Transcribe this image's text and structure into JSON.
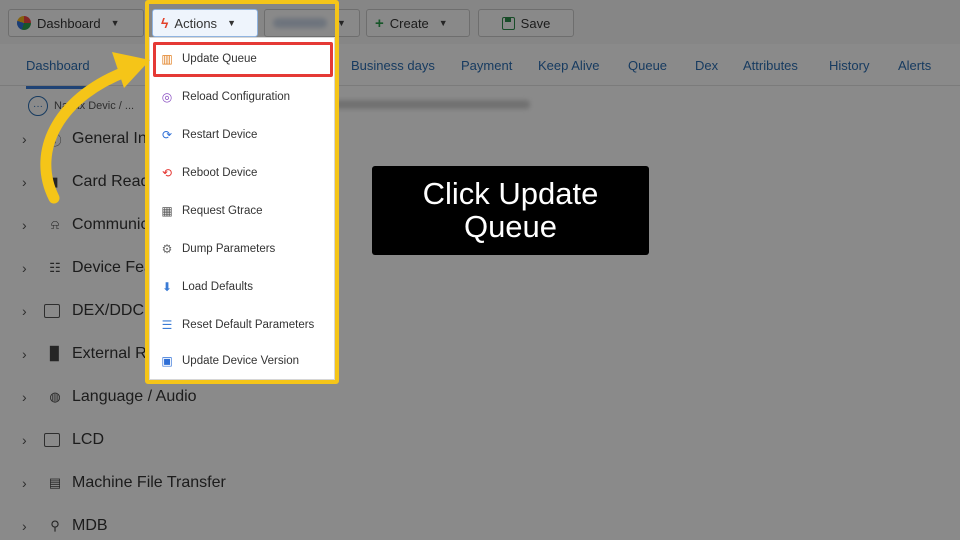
{
  "toolbar": {
    "dashboard_label": "Dashboard",
    "actions_label": "Actions",
    "create_label": "Create",
    "save_label": "Save"
  },
  "tabs": [
    {
      "label": "Dashboard"
    },
    {
      "label": "Business days"
    },
    {
      "label": "Payment"
    },
    {
      "label": "Keep Alive"
    },
    {
      "label": "Queue"
    },
    {
      "label": "Dex"
    },
    {
      "label": "Attributes"
    },
    {
      "label": "History"
    },
    {
      "label": "Alerts"
    }
  ],
  "breadcrumb": {
    "text": "Nayax Devic / ..."
  },
  "tree": [
    {
      "label": "General In",
      "icon": "info-icon"
    },
    {
      "label": "Card Read",
      "icon": "card-reader-icon"
    },
    {
      "label": "Communic",
      "icon": "antenna-icon"
    },
    {
      "label": "Device Fea",
      "icon": "features-icon"
    },
    {
      "label": "DEX/DDCI",
      "icon": "dex-icon"
    },
    {
      "label": "External R",
      "icon": "external-reader-icon"
    },
    {
      "label": "Language / Audio",
      "icon": "globe-icon"
    },
    {
      "label": "LCD",
      "icon": "lcd-icon"
    },
    {
      "label": "Machine File Transfer",
      "icon": "ftp-icon"
    },
    {
      "label": "MDB",
      "icon": "mdb-icon"
    }
  ],
  "menu": {
    "items": [
      {
        "label": "Update Queue",
        "icon": "queue-icon"
      },
      {
        "label": "Reload Configuration",
        "icon": "reload-config-icon"
      },
      {
        "label": "Restart Device",
        "icon": "restart-icon"
      },
      {
        "label": "Reboot Device",
        "icon": "reboot-icon"
      },
      {
        "label": "Request Gtrace",
        "icon": "gtrace-icon"
      },
      {
        "label": "Dump Parameters",
        "icon": "dump-icon"
      },
      {
        "label": "Load Defaults",
        "icon": "load-defaults-icon"
      },
      {
        "label": "Reset Default Parameters",
        "icon": "reset-params-icon"
      },
      {
        "label": "Update Device Version",
        "icon": "update-version-icon"
      }
    ]
  },
  "callout": {
    "text": "Click Update Queue"
  },
  "colors": {
    "highlight_frame": "#f5c518",
    "highlight_item": "#e53935",
    "arrow": "#f5c518",
    "callout_bg": "#000000"
  }
}
